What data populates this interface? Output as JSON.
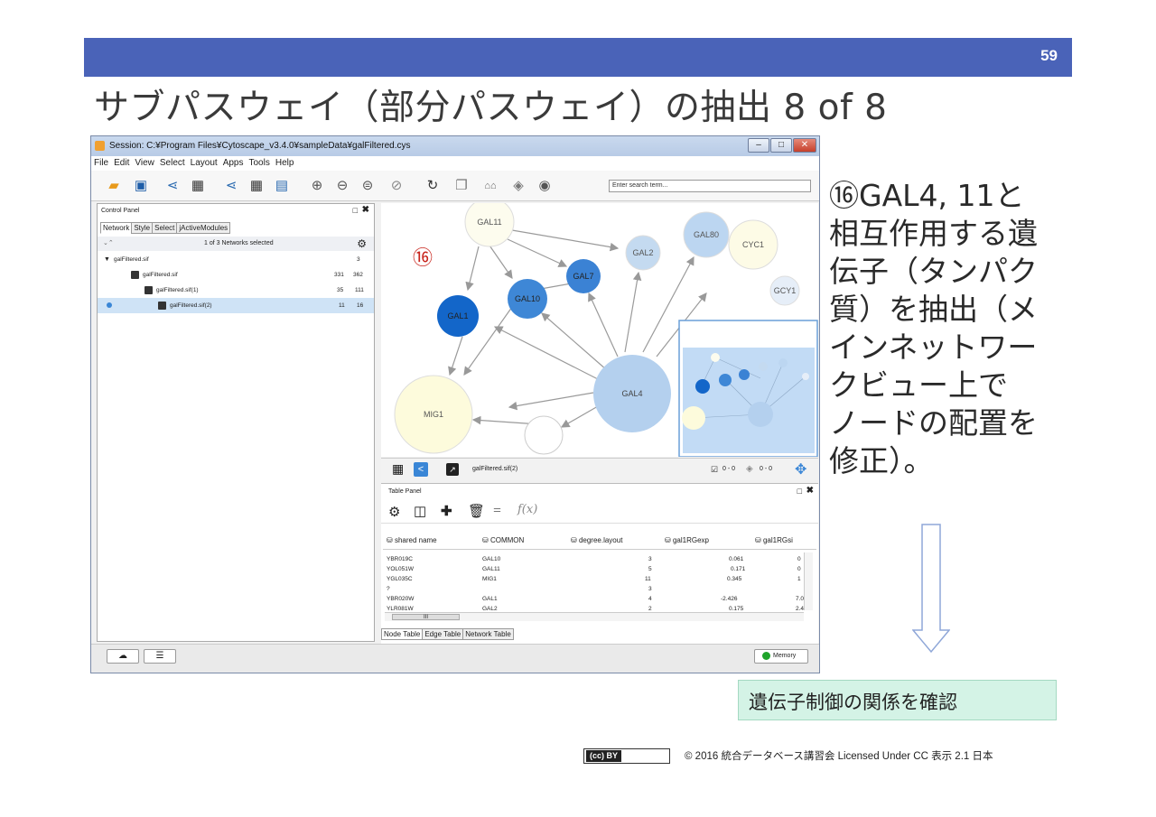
{
  "slide": {
    "page_number": "59",
    "title": "サブパスウェイ（部分パスウェイ）の抽出 8 of 8",
    "annotation_lines": [
      "⑯GAL4, 11と",
      "相互作用する遺",
      "伝子（タンパク",
      "質）を抽出（メ",
      "インネットワー",
      "クビュー上で",
      "ノードの配置を",
      "修正）。"
    ],
    "box_text": "遺伝子制御の関係を確認",
    "cc_label": "(cc) BY",
    "license": "© 2016  統合データベース講習会 Licensed Under CC 表示 2.1 日本",
    "header_color": "#4a63b8"
  },
  "window": {
    "title": "Session: C:¥Program Files¥Cytoscape_v3.4.0¥sampleData¥galFiltered.cys",
    "menu": [
      "File",
      "Edit",
      "View",
      "Select",
      "Layout",
      "Apps",
      "Tools",
      "Help"
    ],
    "search_placeholder": "Enter search term...",
    "toolbar_icons": [
      "open-folder-icon",
      "save-icon",
      "import-network-icon",
      "import-table-icon",
      "export-network-icon",
      "export-table-icon",
      "export-image-icon",
      "zoom-in-icon",
      "zoom-out-icon",
      "zoom-fit-icon",
      "zoom-selected-icon",
      "refresh-icon",
      "new-network-icon",
      "home-icon",
      "hide-icon",
      "show-icon"
    ]
  },
  "control_panel": {
    "title": "Control Panel",
    "tabs": [
      "Network",
      "Style",
      "Select",
      "jActiveModules"
    ],
    "selection_text": "1 of 3 Networks selected",
    "networks": [
      {
        "name": "galFiltered.sif",
        "c1": "",
        "c2": "3"
      },
      {
        "name": "galFiltered.sif",
        "c1": "331",
        "c2": "362"
      },
      {
        "name": "galFiltered.sif(1)",
        "c1": "35",
        "c2": "111"
      },
      {
        "name": "galFiltered.sif(2)",
        "c1": "11",
        "c2": "16"
      }
    ]
  },
  "network_view": {
    "step_marker": "⑯",
    "status_network": "galFiltered.sif(2)",
    "selected_counts": "0 - 0",
    "hidden_counts": "0 - 0",
    "nodes": [
      "GAL11",
      "GAL80",
      "CYC1",
      "GAL2",
      "GAL7",
      "GAL10",
      "GCY1",
      "GAL1",
      "GAL4",
      "MIG1",
      ""
    ]
  },
  "table_panel": {
    "title": "Table Panel",
    "function_label": "f(x)",
    "columns": [
      "shared name",
      "COMMON",
      "degree.layout",
      "gal1RGexp",
      "gal1RGsi"
    ],
    "rows": [
      [
        "YBR019C",
        "GAL10",
        "3",
        "0.061",
        "0"
      ],
      [
        "YOL051W",
        "GAL11",
        "5",
        "0.171",
        "0"
      ],
      [
        "YGL035C",
        "MIG1",
        "11",
        "0.345",
        "1"
      ],
      [
        "?",
        "",
        "3",
        "",
        ""
      ],
      [
        "YBR020W",
        "GAL1",
        "4",
        "-2.426",
        "7.0"
      ],
      [
        "YLR081W",
        "GAL2",
        "2",
        "0.175",
        "2.4"
      ]
    ],
    "scroll_label": "III",
    "bottom_tabs": [
      "Node Table",
      "Edge Table",
      "Network Table"
    ]
  },
  "statusbar": {
    "memory_label": "Memory"
  }
}
